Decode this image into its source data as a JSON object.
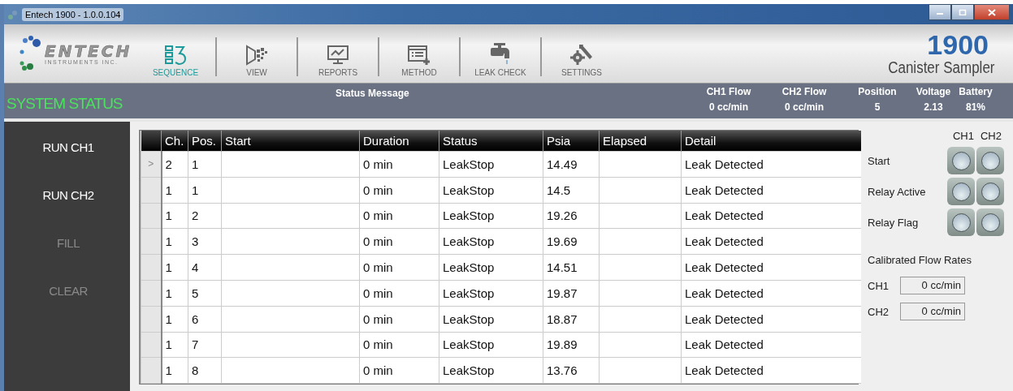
{
  "window": {
    "title": "Entech 1900 - 1.0.0.104"
  },
  "logo": {
    "name": "ENTECH",
    "subtitle": "INSTRUMENTS INC."
  },
  "toolbar": [
    {
      "label": "SEQUENCE",
      "selected": true
    },
    {
      "label": "VIEW",
      "selected": false
    },
    {
      "label": "REPORTS",
      "selected": false
    },
    {
      "label": "METHOD",
      "selected": false
    },
    {
      "label": "LEAK CHECK",
      "selected": false
    },
    {
      "label": "SETTINGS",
      "selected": false
    }
  ],
  "product": {
    "model": "1900",
    "name": "Canister Sampler"
  },
  "status_bar": {
    "title": "SYSTEM STATUS",
    "message_label": "Status Message",
    "readings": [
      {
        "label": "CH1 Flow",
        "value": "0 cc/min"
      },
      {
        "label": "CH2 Flow",
        "value": "0 cc/min"
      },
      {
        "label": "Position",
        "value": "5"
      },
      {
        "label": "Voltage",
        "value": "2.13"
      },
      {
        "label": "Battery",
        "value": "81%"
      }
    ]
  },
  "sidebar": {
    "items": [
      {
        "label": "RUN CH1",
        "disabled": false
      },
      {
        "label": "RUN CH2",
        "disabled": false
      },
      {
        "label": "FILL",
        "disabled": true
      },
      {
        "label": "CLEAR",
        "disabled": true
      }
    ]
  },
  "table": {
    "row_indicator": ">",
    "columns": [
      "Ch.",
      "Pos.",
      "Start",
      "Duration",
      "Status",
      "Psia",
      "Elapsed",
      "Detail"
    ],
    "rows": [
      {
        "selected": true,
        "cells": [
          "2",
          "1",
          "",
          "0 min",
          "LeakStop",
          "14.49",
          "",
          "Leak Detected"
        ]
      },
      {
        "selected": false,
        "cells": [
          "1",
          "1",
          "",
          "0 min",
          "LeakStop",
          "14.5",
          "",
          "Leak Detected"
        ]
      },
      {
        "selected": false,
        "cells": [
          "1",
          "2",
          "",
          "0 min",
          "LeakStop",
          "19.26",
          "",
          "Leak Detected"
        ]
      },
      {
        "selected": false,
        "cells": [
          "1",
          "3",
          "",
          "0 min",
          "LeakStop",
          "19.69",
          "",
          "Leak Detected"
        ]
      },
      {
        "selected": false,
        "cells": [
          "1",
          "4",
          "",
          "0 min",
          "LeakStop",
          "14.51",
          "",
          "Leak Detected"
        ]
      },
      {
        "selected": false,
        "cells": [
          "1",
          "5",
          "",
          "0 min",
          "LeakStop",
          "19.87",
          "",
          "Leak Detected"
        ]
      },
      {
        "selected": false,
        "cells": [
          "1",
          "6",
          "",
          "0 min",
          "LeakStop",
          "18.87",
          "",
          "Leak Detected"
        ]
      },
      {
        "selected": false,
        "cells": [
          "1",
          "7",
          "",
          "0 min",
          "LeakStop",
          "19.89",
          "",
          "Leak Detected"
        ]
      },
      {
        "selected": false,
        "cells": [
          "1",
          "8",
          "",
          "0 min",
          "LeakStop",
          "13.76",
          "",
          "Leak Detected"
        ]
      }
    ]
  },
  "indicators": {
    "columns": [
      "CH1",
      "CH2"
    ],
    "rows": [
      {
        "label": "Start",
        "leds": [
          {
            "on": false
          },
          {
            "on": false
          }
        ]
      },
      {
        "label": "Relay Active",
        "leds": [
          {
            "on": false
          },
          {
            "on": false
          }
        ]
      },
      {
        "label": "Relay Flag",
        "leds": [
          {
            "on": false
          },
          {
            "on": false
          }
        ]
      }
    ]
  },
  "calibrated_flow": {
    "title": "Calibrated Flow Rates",
    "fields": [
      {
        "label": "CH1",
        "value": "0 cc/min"
      },
      {
        "label": "CH2",
        "value": "0 cc/min"
      }
    ]
  }
}
